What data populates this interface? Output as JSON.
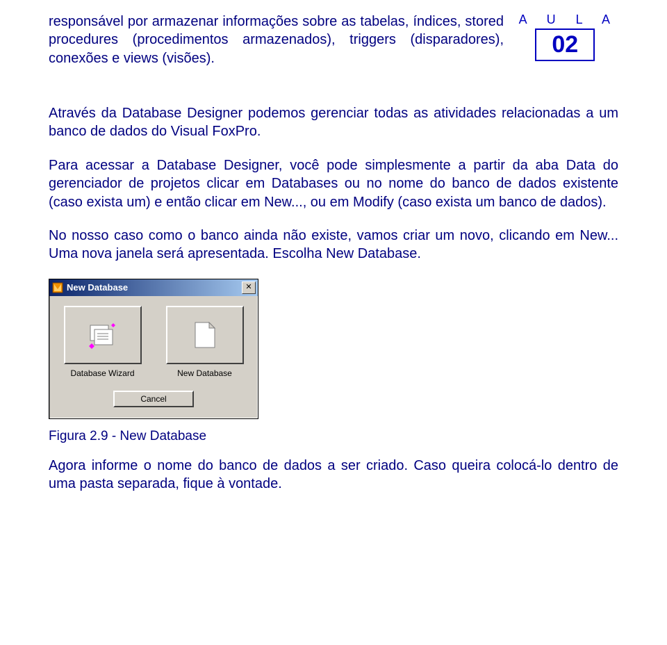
{
  "aula": {
    "label": "A U L A",
    "number": "02"
  },
  "paragraphs": {
    "p1": "responsável por armazenar informações sobre as tabelas, índices, stored procedures (procedimentos armazenados), triggers (disparadores), conexões e views (visões).",
    "p2": "Através da Database Designer podemos gerenciar todas as atividades relacionadas a um banco de dados do Visual FoxPro.",
    "p3": "Para acessar a Database Designer, você pode simplesmente a partir da aba Data do gerenciador de projetos clicar em Databases ou no nome do banco de dados existente (caso exista um) e então clicar em New..., ou em Modify (caso exista um banco de dados).",
    "p4": "No nosso caso como o banco ainda não existe, vamos criar um novo, clicando em New... Uma nova janela será apresentada. Escolha New Database.",
    "caption": "Figura 2.9 - New Database",
    "p5": "Agora informe o nome do banco de dados a ser criado. Caso queira colocá-lo dentro de uma pasta separada, fique à vontade."
  },
  "dialog": {
    "title": "New Database",
    "close": "✕",
    "options": [
      {
        "label": "Database Wizard"
      },
      {
        "label": "New Database"
      }
    ],
    "cancel": "Cancel"
  }
}
